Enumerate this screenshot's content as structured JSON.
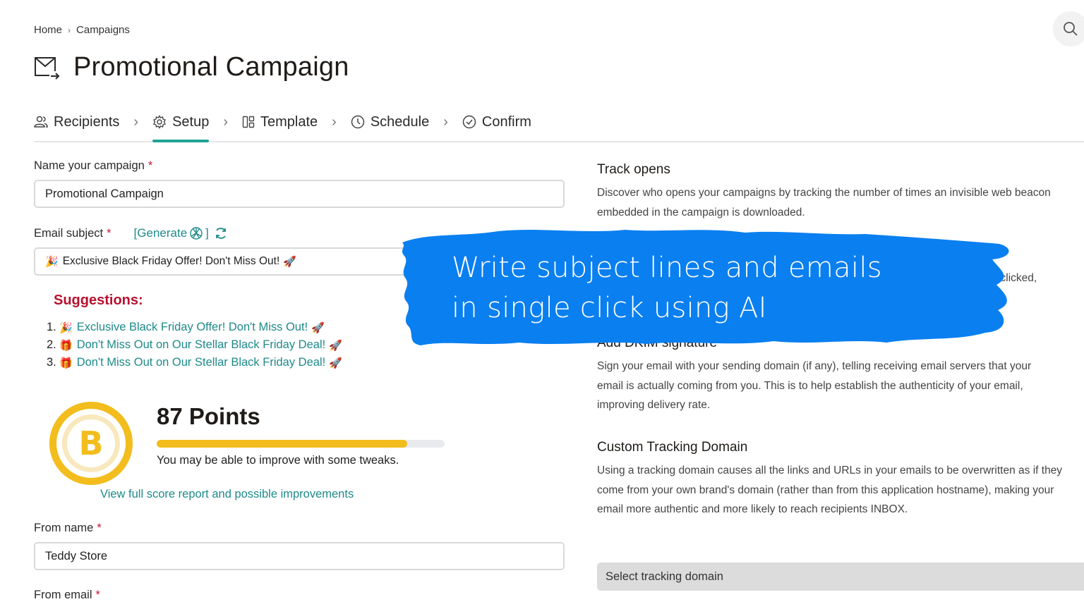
{
  "breadcrumb": {
    "items": [
      "Home",
      "Campaigns"
    ],
    "separator": "›"
  },
  "header": {
    "title": "Promotional Campaign",
    "icon": "mail-send-icon"
  },
  "search": {
    "icon": "search-icon"
  },
  "stepper": {
    "steps": [
      {
        "label": "Recipients",
        "icon": "users-icon",
        "active": false
      },
      {
        "label": "Setup",
        "icon": "gear-icon",
        "active": true
      },
      {
        "label": "Template",
        "icon": "layout-icon",
        "active": false
      },
      {
        "label": "Schedule",
        "icon": "clock-icon",
        "active": false
      },
      {
        "label": "Confirm",
        "icon": "check-circle-icon",
        "active": false
      }
    ],
    "separator": "›"
  },
  "form": {
    "campaign_name": {
      "label": "Name your campaign",
      "required": "*",
      "value": "Promotional Campaign"
    },
    "email_subject": {
      "label": "Email subject",
      "required": "*",
      "generate_label": "[Generate",
      "generate_close": "]",
      "value_emoji": "🎉",
      "value": "Exclusive Black Friday Offer! Don't Miss Out!",
      "value_emoji_after": "🚀"
    },
    "suggestions": {
      "title": "Suggestions:",
      "items": [
        {
          "num": "1.",
          "emoji": "🎉",
          "text": "Exclusive Black Friday Offer! Don't Miss Out!",
          "emoji_after": "🚀"
        },
        {
          "num": "2.",
          "emoji": "🎁",
          "text": "Don't Miss Out on Our Stellar Black Friday Deal!",
          "emoji_after": "🚀"
        },
        {
          "num": "3.",
          "emoji": "🎁",
          "text": "Don't Miss Out on Our Stellar Black Friday Deal!",
          "emoji_after": "🚀"
        }
      ]
    },
    "score": {
      "grade": "B",
      "points_label": "87 Points",
      "progress_percent": 87,
      "message": "You may be able to improve with some tweaks.",
      "report_link": "View full score report and possible improvements",
      "color": "#f2bd1d"
    },
    "from_name": {
      "label": "From name",
      "required": "*",
      "value": "Teddy Store"
    },
    "from_email": {
      "label": "From email",
      "required": "*"
    }
  },
  "settings": {
    "track_opens": {
      "title": "Track opens",
      "description": "Discover who opens your campaigns by tracking the number of times an invisible web beacon embedded in the campaign is downloaded."
    },
    "track_clicks_fragment": "...ey were clicked,",
    "dkim": {
      "title": "Add DKIM signature",
      "description": "Sign your email with your sending domain (if any), telling receiving email servers that your email is actually coming from you. This is to help establish the authenticity of your email, improving delivery rate."
    },
    "tracking_domain": {
      "title": "Custom Tracking Domain",
      "description": "Using a tracking domain causes all the links and URLs in your emails to be overwritten as if they come from your own brand's domain (rather than from this application hostname), making your email more authentic and more likely to reach recipients INBOX.",
      "select_placeholder": "Select tracking domain"
    }
  },
  "overlay": {
    "line1": "Write subject lines and emails",
    "line2": "in single click using AI",
    "color": "#0a7ff0"
  },
  "colors": {
    "accent": "#1fa394",
    "link": "#1e8a8a",
    "required": "#c4173c",
    "suggestions_title": "#b8102e"
  }
}
